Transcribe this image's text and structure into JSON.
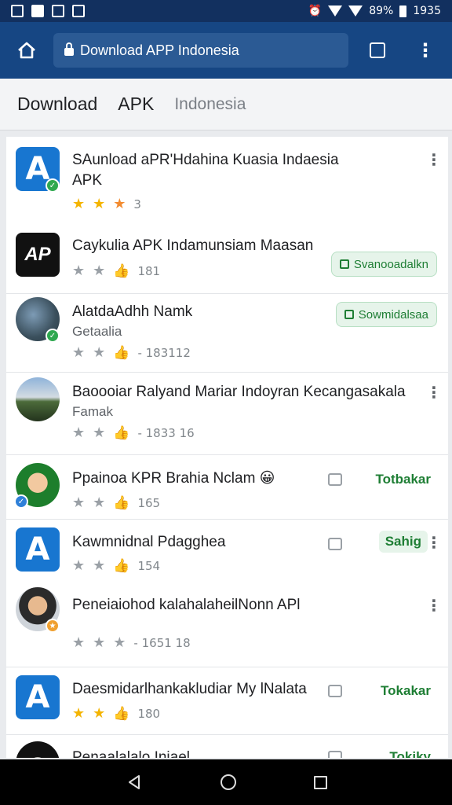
{
  "status_bar": {
    "battery": "89%",
    "time": "1935"
  },
  "browser": {
    "url_title": "Download APP Indonesia",
    "tab_count": ""
  },
  "tabs": [
    {
      "label": "Download"
    },
    {
      "label": "APK"
    },
    {
      "label": "Indonesia"
    }
  ],
  "apps": [
    {
      "title": "SAunload aPR'Hdahina Kuasia Indaesia",
      "title2": "APK",
      "count": "3",
      "action": ""
    },
    {
      "title": "Caykulia APK Indamunsiam Maasan",
      "count": "181",
      "action": "Svanooadalkn"
    },
    {
      "title": "AlatdaAdhh Namk",
      "subtitle": "Getaalia",
      "count": "- 183112",
      "action": "Sowmidalsaa"
    },
    {
      "title": "Baoooiar Ralyand Mariar Indoyran Kecangasakala",
      "subtitle": "Famak",
      "count": "- 1833 16",
      "action": ""
    },
    {
      "title": "Ppainoa KPR Brahia Nclam",
      "emoji": "😀",
      "count": "165",
      "action": "Totbakar"
    },
    {
      "title": "Kawmnidnal Pdagghea",
      "count": "154",
      "action": "Sahig"
    },
    {
      "title": "Peneiaiohod kalahalaheilNonn APl",
      "count": "- 1651 18",
      "action": ""
    },
    {
      "title": "Daesmidarlhankakludiar My lNalata",
      "count": "180",
      "action": "Tokakar"
    },
    {
      "title": "Penaalalalo Iniael",
      "count": "",
      "action": "Tokiky"
    }
  ]
}
